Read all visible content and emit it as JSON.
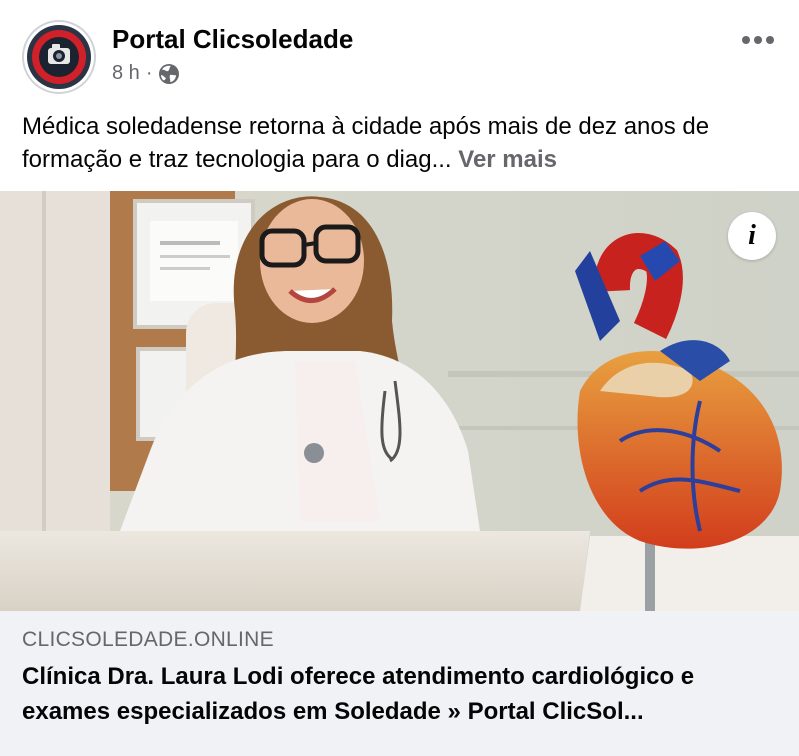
{
  "post": {
    "page_name": "Portal Clicsoledade",
    "time": "8 h",
    "separator": "·",
    "privacy_icon": "globe-icon",
    "more_icon": "more-horizontal-icon",
    "text": "Médica soledadense retorna à cidade após mais de dez anos de formação e traz tecnologia para o diag...",
    "see_more": "Ver mais"
  },
  "media": {
    "info_label": "i",
    "info_icon": "info-icon"
  },
  "link_preview": {
    "domain": "CLICSOLEDADE.ONLINE",
    "title": "Clínica Dra. Laura Lodi oferece atendimento cardiológico e exames especializados em Soledade » Portal ClicSol..."
  },
  "colors": {
    "text_primary": "#050505",
    "text_secondary": "#65676b",
    "link_background": "#f0f2f5",
    "avatar_red": "#d0202a"
  }
}
